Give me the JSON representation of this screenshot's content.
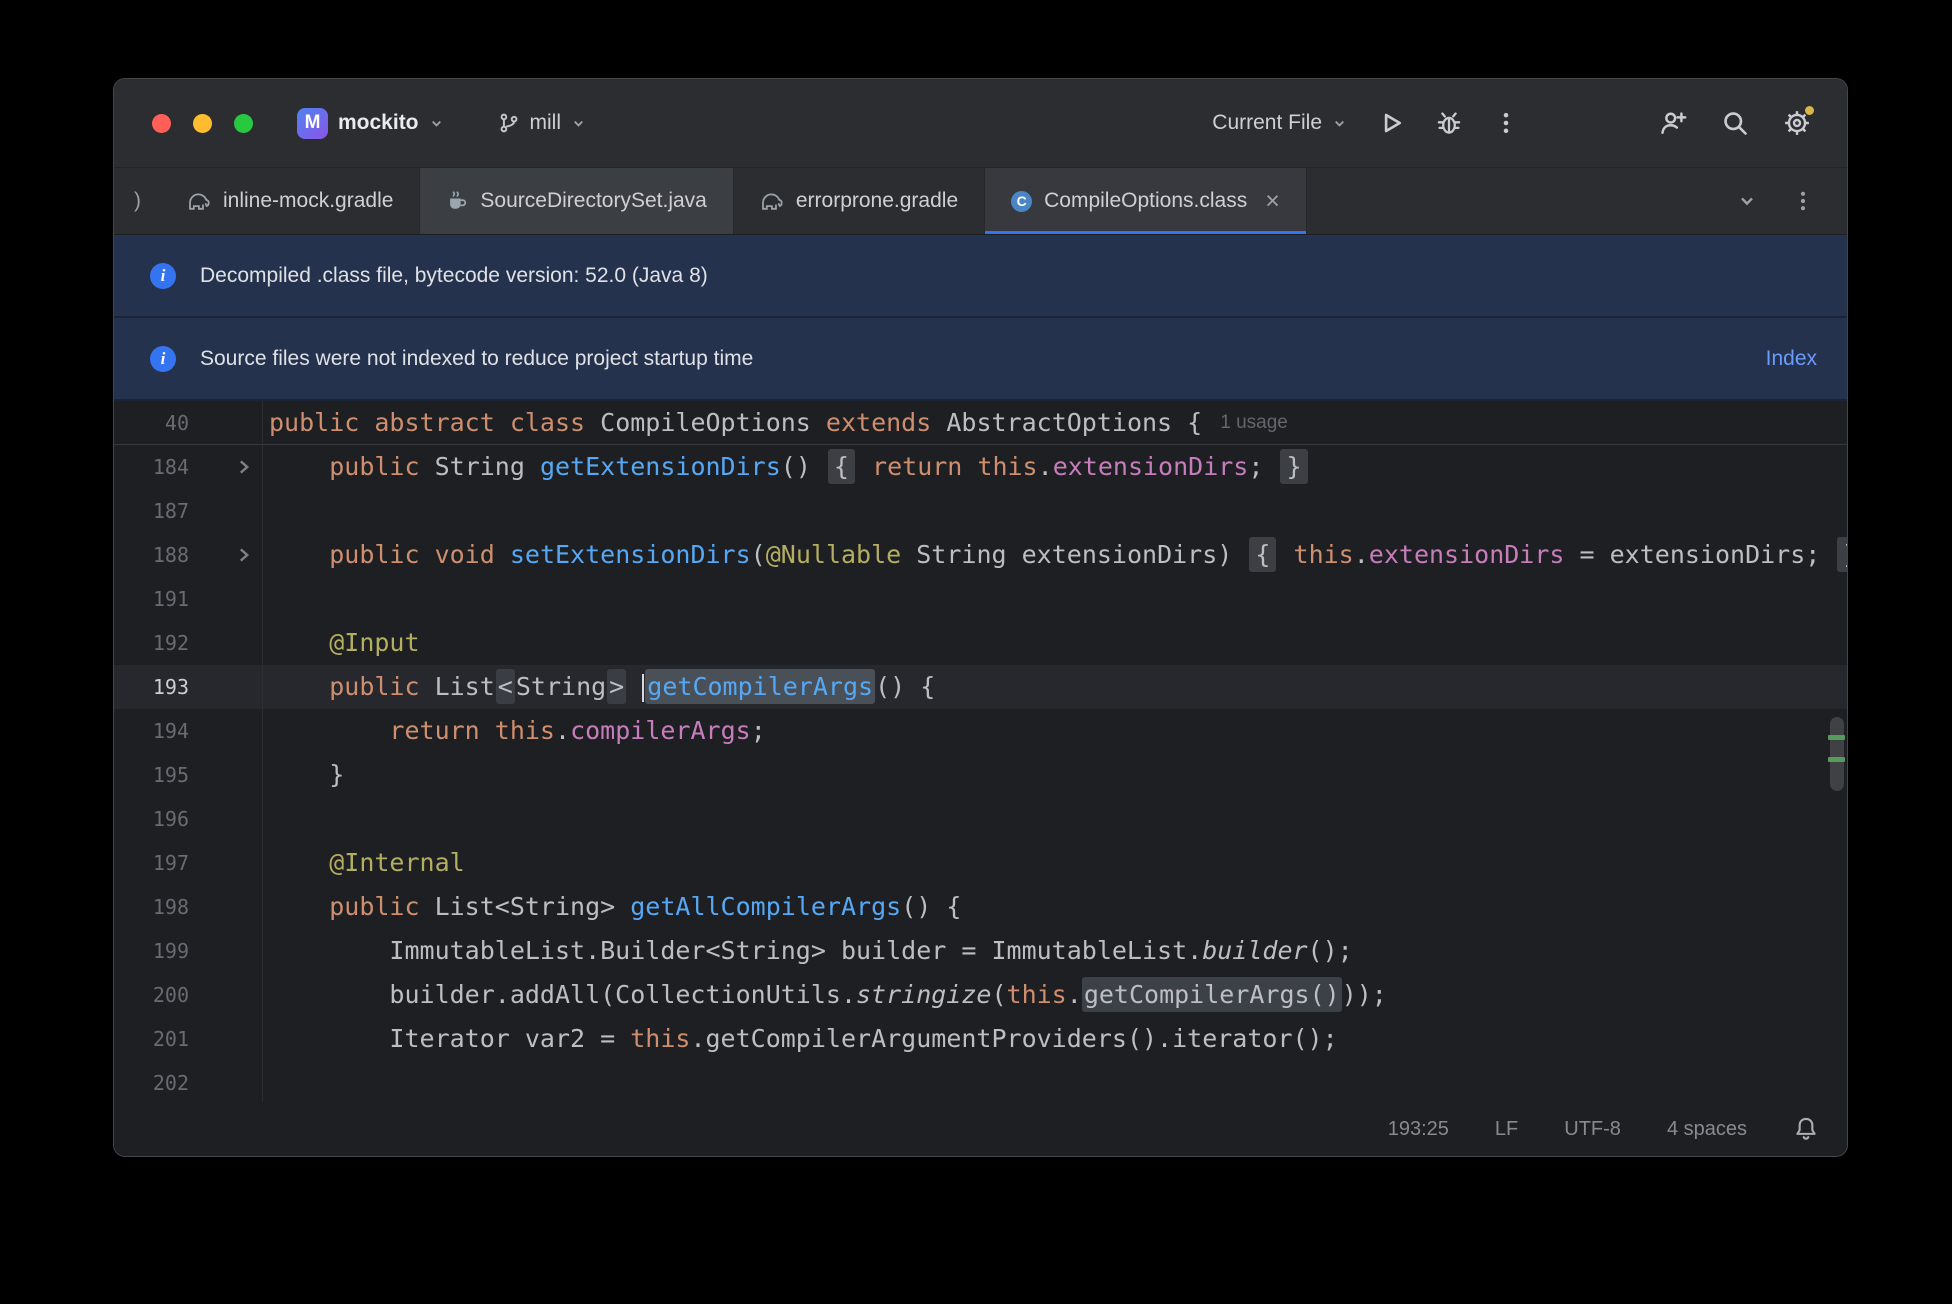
{
  "window": {
    "titlebar": {
      "project": {
        "badge_letter": "M",
        "name": "mockito"
      },
      "branch": "mill",
      "run_config": "Current File"
    },
    "tabbar": {
      "clipped_tab": ")",
      "tabs": [
        {
          "label": "inline-mock.gradle",
          "icon": "gradle-elephant-icon"
        },
        {
          "label": "SourceDirectorySet.java",
          "icon": "java-cup-icon"
        },
        {
          "label": "errorprone.gradle",
          "icon": "gradle-elephant-icon"
        },
        {
          "label": "CompileOptions.class",
          "icon": "class-icon",
          "active": true,
          "closable": true
        }
      ]
    },
    "banners": [
      {
        "icon": "info-icon",
        "text": "Decompiled .class file, bytecode version: 52.0 (Java 8)"
      },
      {
        "icon": "info-icon",
        "text": "Source files were not indexed to reduce project startup time",
        "action": "Index"
      }
    ],
    "editor": {
      "sticky_line": {
        "num": "40",
        "usage": "1 usage",
        "segs": [
          [
            "public abstract class ",
            "k"
          ],
          [
            "CompileOptions ",
            "p"
          ],
          [
            "extends ",
            "k"
          ],
          [
            "AbstractOptions {",
            "p"
          ]
        ]
      },
      "lines": [
        {
          "num": "184",
          "fold": true,
          "segs": [
            [
              "    ",
              "p"
            ],
            [
              "public ",
              "k"
            ],
            [
              "String ",
              "p"
            ],
            [
              "getExtensionDirs",
              "m"
            ],
            [
              "() ",
              "p"
            ],
            [
              "{",
              "fo"
            ],
            [
              " ",
              "p"
            ],
            [
              "return ",
              "k"
            ],
            [
              "this",
              "k"
            ],
            [
              ".",
              "p"
            ],
            [
              "extensionDirs",
              "f"
            ],
            [
              "; ",
              "p"
            ],
            [
              "}",
              "fo"
            ]
          ]
        },
        {
          "num": "187",
          "segs": []
        },
        {
          "num": "188",
          "fold": true,
          "segs": [
            [
              "    ",
              "p"
            ],
            [
              "public ",
              "k"
            ],
            [
              "void ",
              "k"
            ],
            [
              "setExtensionDirs",
              "m"
            ],
            [
              "(",
              "p"
            ],
            [
              "@Nullable",
              "a"
            ],
            [
              " String extensionDirs) ",
              "p"
            ],
            [
              "{",
              "fo"
            ],
            [
              " ",
              "p"
            ],
            [
              "this",
              "k"
            ],
            [
              ".",
              "p"
            ],
            [
              "extensionDirs",
              "f"
            ],
            [
              " = extensionDirs; ",
              "p"
            ],
            [
              "}",
              "fo"
            ]
          ]
        },
        {
          "num": "191",
          "segs": []
        },
        {
          "num": "192",
          "segs": [
            [
              "    ",
              "p"
            ],
            [
              "@Input",
              "a"
            ]
          ]
        },
        {
          "num": "193",
          "cur": true,
          "segs": [
            [
              "    ",
              "p"
            ],
            [
              "public ",
              "k"
            ],
            [
              "List",
              "p"
            ],
            [
              "<",
              "br"
            ],
            [
              "String",
              "p"
            ],
            [
              ">",
              "br"
            ],
            [
              " ",
              "p"
            ],
            [
              "",
              "cr"
            ],
            [
              "getCompilerArgs",
              "hm"
            ],
            [
              "() {",
              "p"
            ]
          ]
        },
        {
          "num": "194",
          "segs": [
            [
              "        ",
              "p"
            ],
            [
              "return ",
              "k"
            ],
            [
              "this",
              "k"
            ],
            [
              ".",
              "p"
            ],
            [
              "compilerArgs",
              "f"
            ],
            [
              ";",
              "p"
            ]
          ]
        },
        {
          "num": "195",
          "segs": [
            [
              "    }",
              "p"
            ]
          ]
        },
        {
          "num": "196",
          "segs": []
        },
        {
          "num": "197",
          "segs": [
            [
              "    ",
              "p"
            ],
            [
              "@Internal",
              "a"
            ]
          ]
        },
        {
          "num": "198",
          "segs": [
            [
              "    ",
              "p"
            ],
            [
              "public ",
              "k"
            ],
            [
              "List<String> ",
              "p"
            ],
            [
              "getAllCompilerArgs",
              "m"
            ],
            [
              "() {",
              "p"
            ]
          ]
        },
        {
          "num": "199",
          "segs": [
            [
              "        ImmutableList.Builder<String> builder = ImmutableList.",
              "p"
            ],
            [
              "builder",
              "i"
            ],
            [
              "();",
              "p"
            ]
          ]
        },
        {
          "num": "200",
          "segs": [
            [
              "        builder.addAll(CollectionUtils.",
              "p"
            ],
            [
              "stringize",
              "i"
            ],
            [
              "(",
              "p"
            ],
            [
              "this",
              "k"
            ],
            [
              ".",
              "p"
            ],
            [
              "getCompilerArgs()",
              "hp"
            ],
            [
              "));",
              "p"
            ]
          ]
        },
        {
          "num": "201",
          "segs": [
            [
              "        Iterator var2 = ",
              "p"
            ],
            [
              "this",
              "k"
            ],
            [
              ".getCompilerArgumentProviders().iterator();",
              "p"
            ]
          ]
        },
        {
          "num": "202",
          "segs": []
        }
      ]
    },
    "statusbar": {
      "caret": "193:25",
      "line_separator": "LF",
      "encoding": "UTF-8",
      "indent": "4 spaces"
    },
    "colors": {
      "accent_blue": "#3574f0",
      "panel_bg": "#2b2d30",
      "editor_bg": "#1e1f22",
      "banner_bg": "#25324d",
      "current_line": "#26282e",
      "keyword": "#cf8e6d",
      "method": "#56a8f5",
      "field": "#c77dbb",
      "annotation": "#b3ae60",
      "vcs_added_green": "#579a5e"
    }
  }
}
